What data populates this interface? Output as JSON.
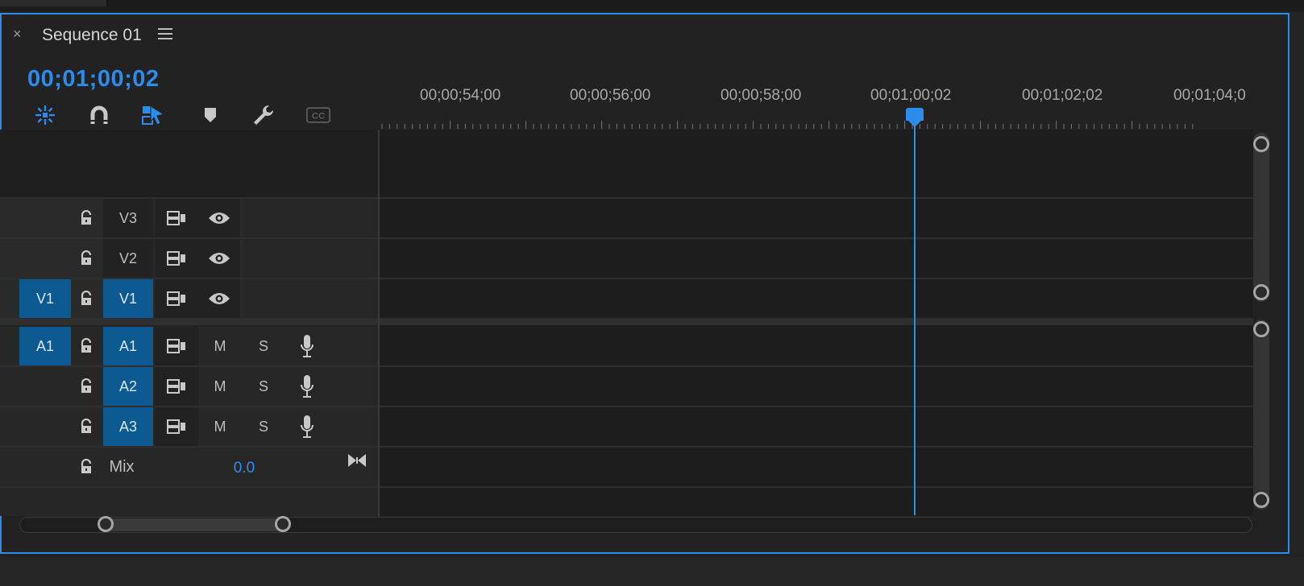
{
  "window": {
    "close_symbol": "×",
    "title": "Sequence 01",
    "menu_icon": "hamburger-menu-icon"
  },
  "timecode": "00;01;00;02",
  "toolbar": [
    {
      "name": "insert-overwrite-nest-icon",
      "active": true
    },
    {
      "name": "snap-magnet-icon",
      "active": false
    },
    {
      "name": "linked-selection-icon",
      "active": true
    },
    {
      "name": "add-marker-icon",
      "active": false
    },
    {
      "name": "timeline-settings-wrench-icon",
      "active": false
    },
    {
      "name": "captions-cc-icon",
      "active": false,
      "label": "CC"
    }
  ],
  "ruler": {
    "labels": [
      "00;00;54;00",
      "00;00;56;00",
      "00;00;58;00",
      "00;01;00;02",
      "00;01;02;02",
      "00;01;04;0"
    ]
  },
  "video_tracks": [
    {
      "source": "",
      "target": "V3",
      "visibility_icon": "eye-icon"
    },
    {
      "source": "",
      "target": "V2",
      "visibility_icon": "eye-icon"
    },
    {
      "source": "V1",
      "target": "V1",
      "visibility_icon": "eye-icon"
    }
  ],
  "audio_tracks": [
    {
      "source": "A1",
      "target": "A1",
      "mute": "M",
      "solo": "S",
      "voice_icon": "microphone-icon"
    },
    {
      "source": "",
      "target": "A2",
      "mute": "M",
      "solo": "S",
      "voice_icon": "microphone-icon"
    },
    {
      "source": "",
      "target": "A3",
      "mute": "M",
      "solo": "S",
      "voice_icon": "microphone-icon"
    }
  ],
  "mix": {
    "label": "Mix",
    "value": "0.0",
    "icon": "bow-tie-icon"
  },
  "colors": {
    "accent": "#2d8ceb",
    "track_target": "#0d5a93",
    "panel_bg": "#222222"
  }
}
